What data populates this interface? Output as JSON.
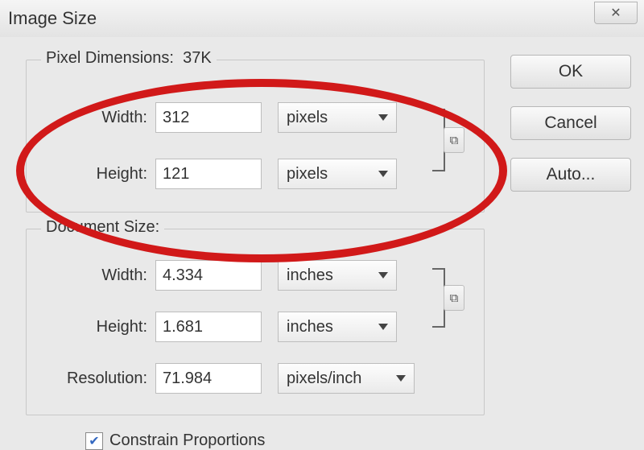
{
  "window": {
    "title": "Image Size",
    "close_glyph": "✕"
  },
  "pixel_dimensions": {
    "legend_prefix": "Pixel Dimensions:",
    "file_size": "37K",
    "width_label": "Width:",
    "width_value": "312",
    "width_unit": "pixels",
    "height_label": "Height:",
    "height_value": "121",
    "height_unit": "pixels"
  },
  "document_size": {
    "legend": "Document Size:",
    "width_label": "Width:",
    "width_value": "4.334",
    "width_unit": "inches",
    "height_label": "Height:",
    "height_value": "1.681",
    "height_unit": "inches",
    "resolution_label": "Resolution:",
    "resolution_value": "71.984",
    "resolution_unit": "pixels/inch"
  },
  "link_glyph": "⧉",
  "checkbox": {
    "constrain_label": "Constrain Proportions",
    "constrain_checked_glyph": "✔"
  },
  "buttons": {
    "ok": "OK",
    "cancel": "Cancel",
    "auto": "Auto..."
  }
}
